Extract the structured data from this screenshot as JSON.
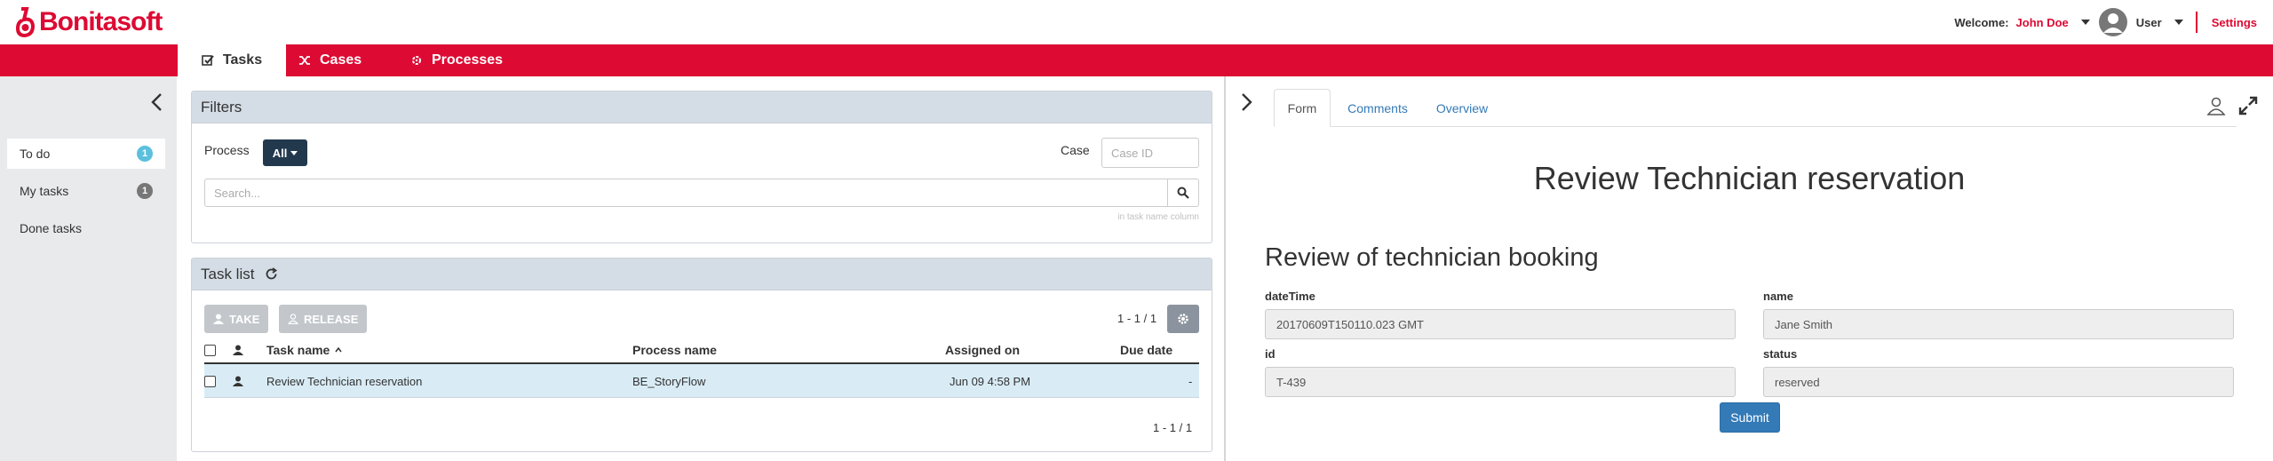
{
  "header": {
    "logo_text": "Bonitasoft",
    "welcome_label": "Welcome:",
    "user_name": "John Doe",
    "profile_label": "User",
    "settings_label": "Settings"
  },
  "nav": {
    "tabs": [
      {
        "label": "Tasks",
        "icon": "check-square-icon",
        "active": true
      },
      {
        "label": "Cases",
        "icon": "shuffle-icon",
        "active": false
      },
      {
        "label": "Processes",
        "icon": "cogs-icon",
        "active": false
      }
    ]
  },
  "sidebar": {
    "items": [
      {
        "label": "To do",
        "badge": "1",
        "badge_color": "#5bc0de",
        "active": true
      },
      {
        "label": "My tasks",
        "badge": "1",
        "badge_color": "#777777",
        "active": false
      },
      {
        "label": "Done tasks",
        "badge": "",
        "active": false
      }
    ]
  },
  "filters": {
    "title": "Filters",
    "process_label": "Process",
    "process_value": "All",
    "case_label": "Case",
    "case_placeholder": "Case ID",
    "search_placeholder": "Search...",
    "search_hint": "in task name column"
  },
  "tasklist": {
    "title": "Task list",
    "take_label": "TAKE",
    "release_label": "RELEASE",
    "pager_top": "1 - 1 / 1",
    "pager_bottom": "1 - 1 / 1",
    "columns": [
      "Task name",
      "Process name",
      "Assigned on",
      "Due date"
    ],
    "rows": [
      {
        "task_name": "Review Technician reservation",
        "process_name": "BE_StoryFlow",
        "assigned_on": "Jun 09 4:58 PM",
        "due_date": "-"
      }
    ]
  },
  "form": {
    "tabs": [
      "Form",
      "Comments",
      "Overview"
    ],
    "title": "Review Technician reservation",
    "subtitle": "Review of technician booking",
    "fields": {
      "datetime_label": "dateTime",
      "datetime_value": "20170609T150110.023 GMT",
      "name_label": "name",
      "name_value": "Jane Smith",
      "id_label": "id",
      "id_value": "T-439",
      "status_label": "status",
      "status_value": "reserved"
    },
    "submit_label": "Submit"
  },
  "colors": {
    "brand_red": "#dd0a33",
    "header_dark": "#22384d",
    "link_blue": "#337ab7",
    "row_highlight": "#d9ecf6"
  }
}
